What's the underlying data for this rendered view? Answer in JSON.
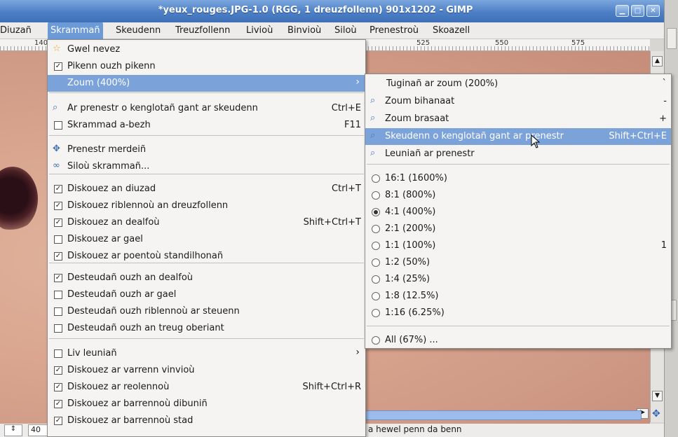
{
  "window": {
    "title": "*yeux_rouges.JPG-1.0 (RGG, 1 dreuzfollenn) 901x1202 - GIMP",
    "buttons": [
      "minimize",
      "maximize",
      "close"
    ]
  },
  "menubar": [
    {
      "label": "Diuzañ"
    },
    {
      "label": "Skrammañ",
      "active": true
    },
    {
      "label": "Skeudenn"
    },
    {
      "label": "Treuzfollenn"
    },
    {
      "label": "Livioù"
    },
    {
      "label": "Binvioù"
    },
    {
      "label": "Siloù"
    },
    {
      "label": "Prenestroù"
    },
    {
      "label": "Skoazell"
    }
  ],
  "ruler": {
    "labels": [
      "140",
      "525",
      "550",
      "575"
    ]
  },
  "view_menu": {
    "items": [
      {
        "kind": "icon",
        "icon": "new-view-icon",
        "label": "Gwel nevez"
      },
      {
        "kind": "check",
        "checked": true,
        "label": "Pikenn ouzh pikenn"
      },
      {
        "kind": "submenu",
        "label": "Zoum (400%)",
        "selected": true
      },
      {
        "kind": "icon",
        "icon": "zoom-fit-icon",
        "label": "Ar prenestr o kenglotañ gant ar skeudenn",
        "accel": "Ctrl+E"
      },
      {
        "kind": "check",
        "checked": false,
        "label": "Skrammad a-bezh",
        "accel": "F11"
      },
      {
        "kind": "icon",
        "icon": "navigate-icon",
        "label": "Prenestr merdeiñ"
      },
      {
        "kind": "icon",
        "icon": "display-filters-icon",
        "label": "Siloù skrammañ..."
      },
      {
        "kind": "check",
        "checked": true,
        "label": "Diskouez an diuzad",
        "accel": "Ctrl+T"
      },
      {
        "kind": "check",
        "checked": true,
        "label": "Diskouez riblennoù an dreuzfollenn"
      },
      {
        "kind": "check",
        "checked": true,
        "label": "Diskouez an dealfoù",
        "accel": "Shift+Ctrl+T"
      },
      {
        "kind": "check",
        "checked": false,
        "label": "Diskouez ar gael"
      },
      {
        "kind": "check",
        "checked": true,
        "label": "Diskouez ar poentoù standilhonañ"
      },
      {
        "kind": "check",
        "checked": true,
        "label": "Desteudañ ouzh an dealfoù"
      },
      {
        "kind": "check",
        "checked": false,
        "label": "Desteudañ ouzh ar gael"
      },
      {
        "kind": "check",
        "checked": false,
        "label": "Desteudañ ouzh riblennoù ar steuenn"
      },
      {
        "kind": "check",
        "checked": false,
        "label": "Desteudañ ouzh an treug oberiant"
      },
      {
        "kind": "check",
        "checked": false,
        "label": "Liv leuniañ",
        "submenu": true
      },
      {
        "kind": "check",
        "checked": true,
        "label": "Diskouez ar varrenn vinvioù"
      },
      {
        "kind": "check",
        "checked": true,
        "label": "Diskouez ar reolennoù",
        "accel": "Shift+Ctrl+R"
      },
      {
        "kind": "check",
        "checked": true,
        "label": "Diskouez ar barrennoù dibuniñ"
      },
      {
        "kind": "check",
        "checked": true,
        "label": "Diskouez ar barrennoù stad"
      }
    ]
  },
  "zoom_menu": {
    "items": [
      {
        "kind": "plain",
        "label": "Tuginañ ar zoum (200%)",
        "accel": "`"
      },
      {
        "kind": "icon",
        "label": "Zoum bihanaat",
        "accel": "-"
      },
      {
        "kind": "icon",
        "label": "Zoum brasaat",
        "accel": "+"
      },
      {
        "kind": "icon",
        "label": "Skeudenn o kenglotañ gant ar prenestr",
        "accel": "Shift+Ctrl+E",
        "selected": true
      },
      {
        "kind": "icon",
        "label": "Leuniañ ar prenestr"
      },
      {
        "kind": "radio",
        "label": "16:1 (1600%)"
      },
      {
        "kind": "radio",
        "label": "8:1 (800%)"
      },
      {
        "kind": "radio",
        "label": "4:1 (400%)",
        "checked": true
      },
      {
        "kind": "radio",
        "label": "2:1 (200%)"
      },
      {
        "kind": "radio",
        "label": "1:1 (100%)",
        "accel": "1"
      },
      {
        "kind": "radio",
        "label": "1:2 (50%)"
      },
      {
        "kind": "radio",
        "label": "1:4 (25%)"
      },
      {
        "kind": "radio",
        "label": "1:8 (12.5%)"
      },
      {
        "kind": "radio",
        "label": "1:16 (6.25%)"
      },
      {
        "kind": "radio",
        "label": "All (67%) ..."
      }
    ]
  },
  "statusbar": {
    "zoom_value": "40",
    "message": "a hewel penn da benn"
  },
  "colors": {
    "accent": "#7ba3da",
    "titlebar": "#4d7fc6"
  }
}
